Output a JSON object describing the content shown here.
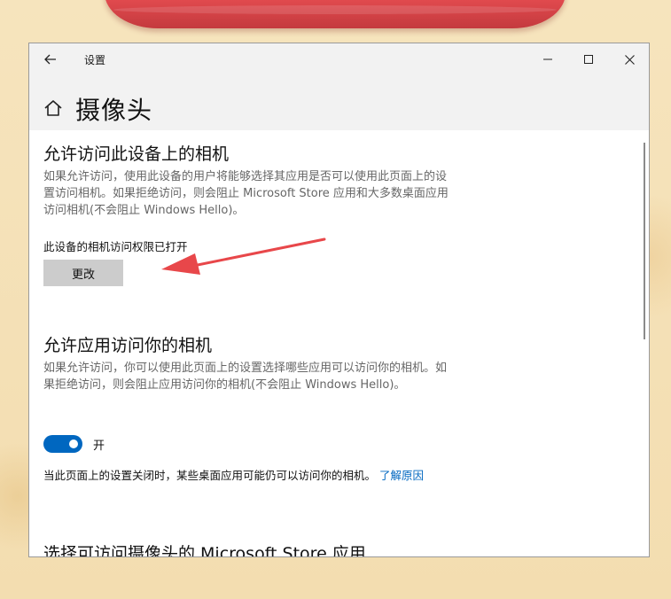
{
  "window": {
    "title": "设置",
    "back_icon": "back-arrow-icon",
    "controls": [
      "minimize-icon",
      "maximize-icon",
      "close-icon"
    ]
  },
  "page": {
    "title": "摄像头",
    "home_icon": "home-icon"
  },
  "device_section": {
    "title": "允许访问此设备上的相机",
    "description": "如果允许访问，使用此设备的用户将能够选择其应用是否可以使用此页面上的设置访问相机。如果拒绝访问，则会阻止 Microsoft Store 应用和大多数桌面应用访问相机(不会阻止 Windows Hello)。",
    "status": "此设备的相机访问权限已打开",
    "change_button": "更改"
  },
  "apps_section": {
    "title": "允许应用访问你的相机",
    "description": "如果允许访问，你可以使用此页面上的设置选择哪些应用可以访问你的相机。如果拒绝访问，则会阻止应用访问你的相机(不会阻止 Windows Hello)。",
    "toggle_label": "开",
    "toggle_on": true,
    "note": "当此页面上的设置关闭时，某些桌面应用可能仍可以访问你的相机。",
    "learn_link": "了解原因"
  },
  "store_section": {
    "title": "选择可访问摄像头的 Microsoft Store 应用"
  },
  "colors": {
    "accent": "#0067c0",
    "annotation_arrow": "#e8474a",
    "ribbon": "#d63c42"
  }
}
